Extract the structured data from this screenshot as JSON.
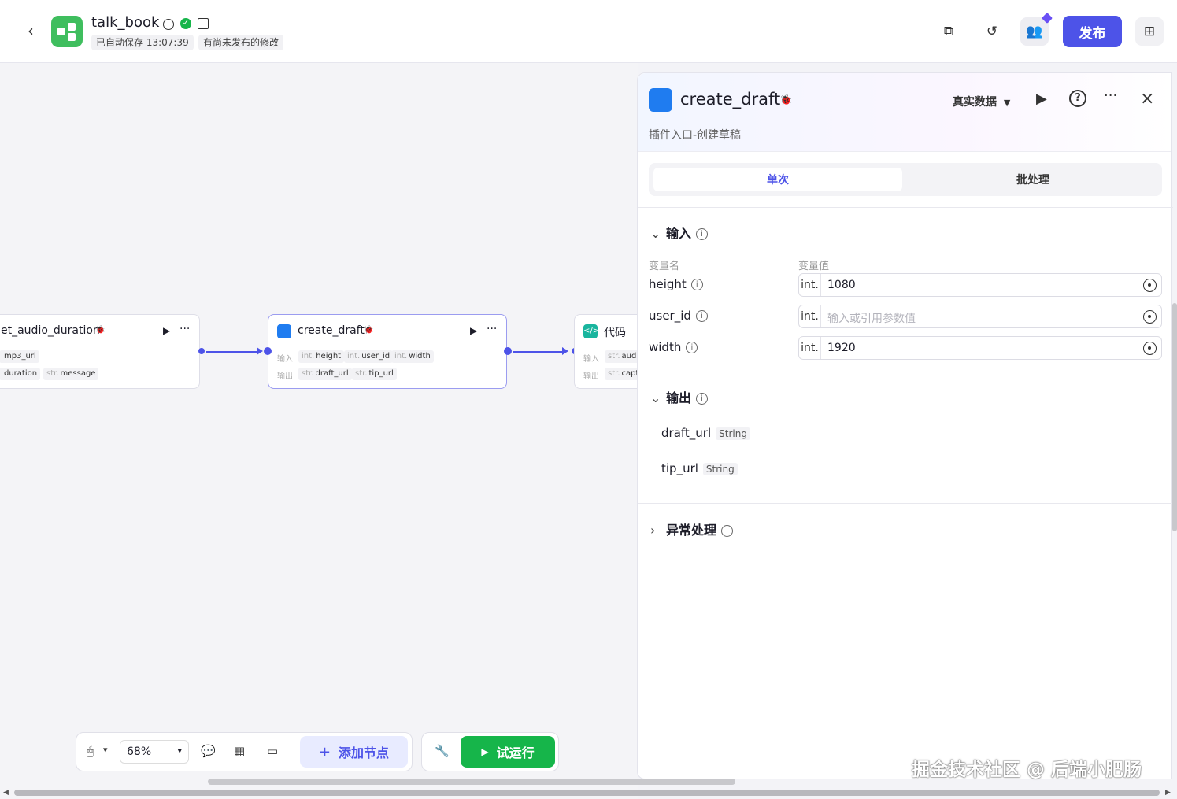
{
  "header": {
    "back": "‹",
    "app_name": "talk_book",
    "autosave": "已自动保存 13:07:39",
    "unpublished": "有尚未发布的修改",
    "publish": "发布"
  },
  "canvas": {
    "nodes": [
      {
        "title": "et_audio_duration",
        "in_label": "",
        "out_label": "",
        "inputs": [
          {
            "type": "",
            "name": "mp3_url"
          }
        ],
        "outputs": [
          {
            "type": "",
            "name": "duration"
          },
          {
            "type": "str.",
            "name": "message"
          }
        ]
      },
      {
        "title": "create_draft",
        "in_label": "输入",
        "out_label": "输出",
        "inputs": [
          {
            "type": "int.",
            "name": "height"
          },
          {
            "type": "int.",
            "name": "user_id"
          },
          {
            "type": "int.",
            "name": "width"
          }
        ],
        "outputs": [
          {
            "type": "str.",
            "name": "draft_url"
          },
          {
            "type": "str.",
            "name": "tip_url"
          }
        ]
      },
      {
        "title": "代码",
        "in_label": "输入",
        "out_label": "输出",
        "inputs": [
          {
            "type": "str.",
            "name": "audio"
          }
        ],
        "outputs": [
          {
            "type": "str.",
            "name": "capti"
          }
        ]
      }
    ]
  },
  "toolbar": {
    "zoom": "68%",
    "add_node": "添加节点",
    "test_run": "试运行"
  },
  "panel": {
    "title": "create_draft",
    "description": "插件入口-创建草稿",
    "data_mode": "真实数据",
    "tabs": [
      "单次",
      "批处理"
    ],
    "input_section": "输入",
    "col_name": "变量名",
    "col_value": "变量值",
    "inputs": [
      {
        "name": "height",
        "type": "int.",
        "value": "1080",
        "placeholder": ""
      },
      {
        "name": "user_id",
        "type": "int.",
        "value": "",
        "placeholder": "输入或引用参数值"
      },
      {
        "name": "width",
        "type": "int.",
        "value": "1920",
        "placeholder": ""
      }
    ],
    "output_section": "输出",
    "outputs": [
      {
        "name": "draft_url",
        "type": "String"
      },
      {
        "name": "tip_url",
        "type": "String"
      }
    ],
    "error_section": "异常处理"
  },
  "watermark": "掘金技术社区 @ 后端小肥肠",
  "colors": {
    "accent": "#4d53e8",
    "green": "#16b54a",
    "plugin_blue": "#1f7cf0"
  }
}
